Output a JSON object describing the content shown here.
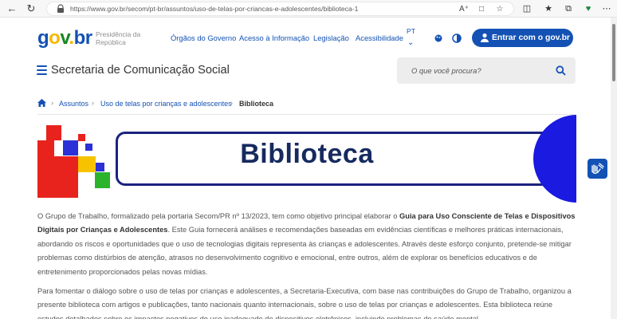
{
  "browser": {
    "url": "https://www.gov.br/secom/pt-br/assuntos/uso-de-telas-por-criancas-e-adolescentes/biblioteca-1"
  },
  "header": {
    "logo_g": "g",
    "logo_o": "o",
    "logo_v": "v",
    "logo_dot": ".",
    "logo_br": "br",
    "presidencia_line1": "Presidência da",
    "presidencia_line2": "República",
    "nav": [
      "Órgãos do Governo",
      "Acesso à Informação",
      "Legislação",
      "Acessibilidade"
    ],
    "lang": "PT",
    "login_label": "Entrar com o  gov.br"
  },
  "subheader": {
    "site_title": "Secretaria de Comunicação Social",
    "search_placeholder": "O que você procura?"
  },
  "breadcrumb": {
    "items": [
      "Assuntos",
      "Uso de telas por crianças e adolescentes"
    ],
    "current": "Biblioteca"
  },
  "banner": {
    "title": "Biblioteca"
  },
  "content": {
    "p1_a": "O Grupo de Trabalho, formalizado pela portaria Secom/PR nº 13/2023, tem como objetivo principal elaborar o ",
    "p1_bold": "Guia para Uso Consciente de Telas e Dispositivos Digitais por Crianças e Adolescentes",
    "p1_b": ". Este Guia fornecerá análises e recomendações baseadas em evidências científicas e melhores práticas internacionais, abordando os riscos e oportunidades que o uso de tecnologias digitais representa às crianças e adolescentes. Através deste esforço conjunto, pretende-se mitigar problemas como distúrbios de atenção, atrasos no desenvolvimento cognitivo e emocional, entre outros, além de explorar os benefícios educativos e de entretenimento proporcionados pelas novas mídias.",
    "p2": "Para fomentar o diálogo sobre o uso de telas por crianças e adolescentes, a Secretaria-Executiva, com base nas contribuições do Grupo de Trabalho, organizou a presente biblioteca com artigos e publicações, tanto nacionais quanto internacionais, sobre o uso de telas por crianças e adolescentes. Esta biblioteca reúne estudos detalhados sobre os impactos negativos do uso inadequado de dispositivos eletrônicos, incluindo problemas de saúde mental"
  },
  "colors": {
    "primary": "#1351b4",
    "logo_yellow": "#f5b800",
    "logo_green": "#168821",
    "banner_navy": "#1a237e",
    "banner_circle": "#1a1ae0",
    "mosaic_red": "#e8231d",
    "mosaic_blue": "#2b31d6",
    "mosaic_yellow": "#f7c300",
    "mosaic_green": "#2cb32c"
  }
}
